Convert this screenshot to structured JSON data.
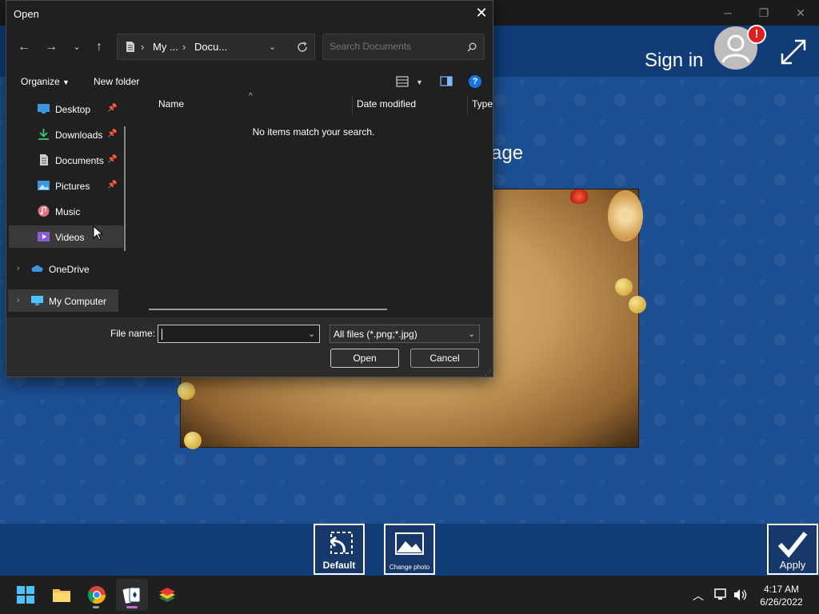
{
  "background_app": {
    "sign_in_label": "Sign in",
    "alert_badge": "!",
    "heading_partial": "age",
    "buttons": {
      "default_label": "Default",
      "change_photo_label": "Change photo",
      "apply_label": "Apply"
    }
  },
  "dialog": {
    "title": "Open",
    "close_glyph": "✕",
    "address": {
      "segments": [
        "My ...",
        "Docu..."
      ]
    },
    "search": {
      "placeholder": "Search Documents"
    },
    "command_bar": {
      "organize_label": "Organize",
      "new_folder_label": "New folder"
    },
    "nav": {
      "quick_access": [
        {
          "label": "Desktop",
          "pinned": true,
          "icon": "desktop-icon"
        },
        {
          "label": "Downloads",
          "pinned": true,
          "icon": "download-icon"
        },
        {
          "label": "Documents",
          "pinned": true,
          "icon": "document-icon"
        },
        {
          "label": "Pictures",
          "pinned": true,
          "icon": "picture-icon"
        },
        {
          "label": "Music",
          "pinned": false,
          "icon": "music-icon"
        },
        {
          "label": "Videos",
          "pinned": false,
          "icon": "video-icon",
          "selected": true
        }
      ],
      "roots": [
        {
          "label": "OneDrive",
          "icon": "cloud-icon"
        },
        {
          "label": "My Computer",
          "icon": "computer-icon"
        }
      ]
    },
    "columns": [
      "Name",
      "Date modified",
      "Type"
    ],
    "empty_message": "No items match your search.",
    "footer": {
      "file_name_label": "File name:",
      "file_name_value": "",
      "file_type_selected": "All files (*.png;*.jpg)",
      "open_label": "Open",
      "cancel_label": "Cancel"
    }
  },
  "taskbar": {
    "clock_time": "4:17 AM",
    "clock_date": "6/26/2022",
    "apps": [
      "start-icon",
      "file-explorer-icon",
      "chrome-icon",
      "solitaire-icon",
      "bluestacks-icon"
    ]
  },
  "colors": {
    "dialog_bg": "#202020",
    "app_blue": "#1c4f92",
    "header_blue": "#123c78",
    "alert_red": "#e11d1d"
  }
}
